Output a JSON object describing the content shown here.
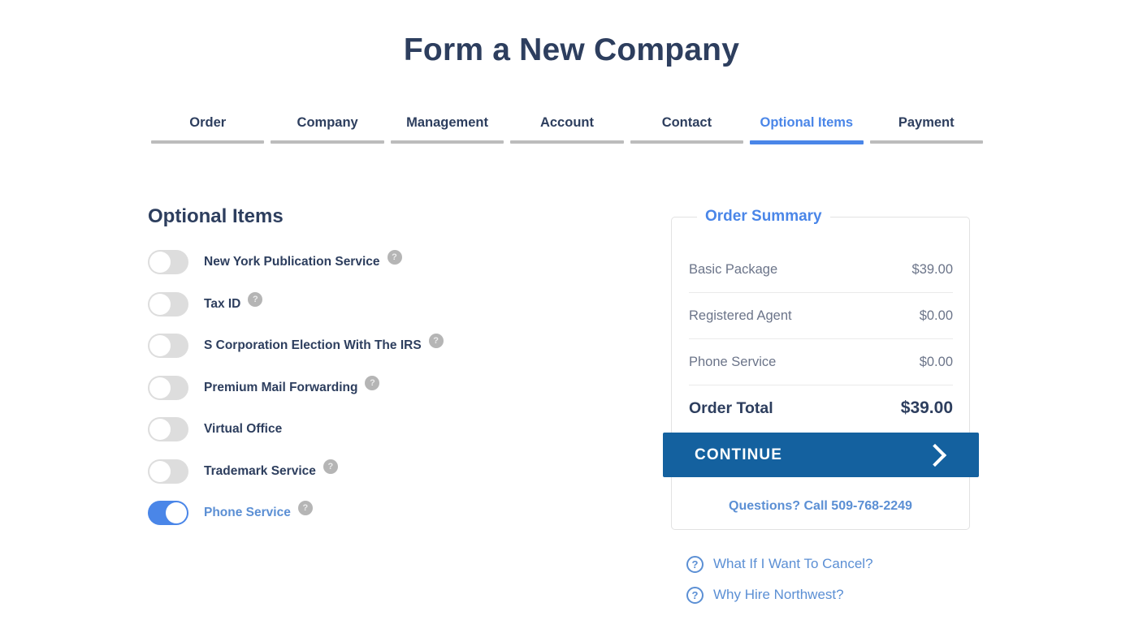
{
  "page": {
    "title": "Form a New Company",
    "section_heading": "Optional Items"
  },
  "tabs": [
    {
      "label": "Order",
      "active": false
    },
    {
      "label": "Company",
      "active": false
    },
    {
      "label": "Management",
      "active": false
    },
    {
      "label": "Account",
      "active": false
    },
    {
      "label": "Contact",
      "active": false
    },
    {
      "label": "Optional Items",
      "active": true
    },
    {
      "label": "Payment",
      "active": false
    }
  ],
  "options": [
    {
      "label": "New York Publication Service",
      "on": false,
      "help": "?"
    },
    {
      "label": "Tax ID",
      "on": false,
      "help": "?"
    },
    {
      "label": "S Corporation Election With The IRS",
      "on": false,
      "help": "?"
    },
    {
      "label": "Premium Mail Forwarding",
      "on": false,
      "help": "?"
    },
    {
      "label": "Virtual Office",
      "on": false,
      "help": null
    },
    {
      "label": "Trademark Service",
      "on": false,
      "help": "?"
    },
    {
      "label": "Phone Service",
      "on": true,
      "help": "?"
    }
  ],
  "order_summary": {
    "legend": "Order Summary",
    "rows": [
      {
        "label": "Basic Package",
        "value": "$39.00"
      },
      {
        "label": "Registered Agent",
        "value": "$0.00"
      },
      {
        "label": "Phone Service",
        "value": "$0.00"
      }
    ],
    "total": {
      "label": "Order Total",
      "value": "$39.00"
    },
    "continue_label": "CONTINUE",
    "phone_link": "Questions? Call 509-768-2249"
  },
  "help_links": [
    {
      "icon": "?",
      "label": "What If I Want To Cancel?"
    },
    {
      "icon": "?",
      "label": "Why Hire Northwest?"
    }
  ],
  "colors": {
    "navy": "#2d3e5e",
    "accent_blue": "#4a86e8",
    "link_blue": "#5b8fd4",
    "button_blue": "#14619f",
    "toggle_off": "#dddddd",
    "muted_text": "#6b7489"
  }
}
